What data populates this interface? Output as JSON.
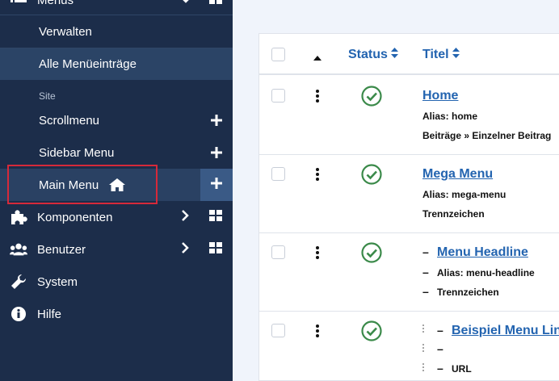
{
  "sidebar": {
    "top_label": "Menüs",
    "sub_items": [
      "Verwalten",
      "Alle Menüeinträge"
    ],
    "section_label": "Site",
    "menus": [
      "Scrollmenu",
      "Sidebar Menu"
    ],
    "main_menu": "Main Menu",
    "items": [
      {
        "label": "Komponenten",
        "icon": "puzzle-icon"
      },
      {
        "label": "Benutzer",
        "icon": "users-icon"
      },
      {
        "label": "System",
        "icon": "wrench-icon"
      },
      {
        "label": "Hilfe",
        "icon": "info-icon"
      }
    ]
  },
  "table": {
    "headers": {
      "status": "Status",
      "title": "Titel"
    },
    "rows": [
      {
        "title": "Home",
        "alias": "Alias: home",
        "type": "Beiträge » Einzelner Beitrag"
      },
      {
        "title": "Mega Menu",
        "alias": "Alias: mega-menu",
        "type": "Trennzeichen"
      },
      {
        "title": "Menu Headline",
        "alias": "Alias: menu-headline",
        "type": "Trennzeichen"
      },
      {
        "title": "Beispiel Menu Link",
        "alias": "",
        "type": "URL"
      }
    ]
  },
  "colors": {
    "sidebar": "#1c2d4a",
    "accent": "#2364b0",
    "status_green": "#3b8a4a",
    "highlight": "#d6293a"
  }
}
